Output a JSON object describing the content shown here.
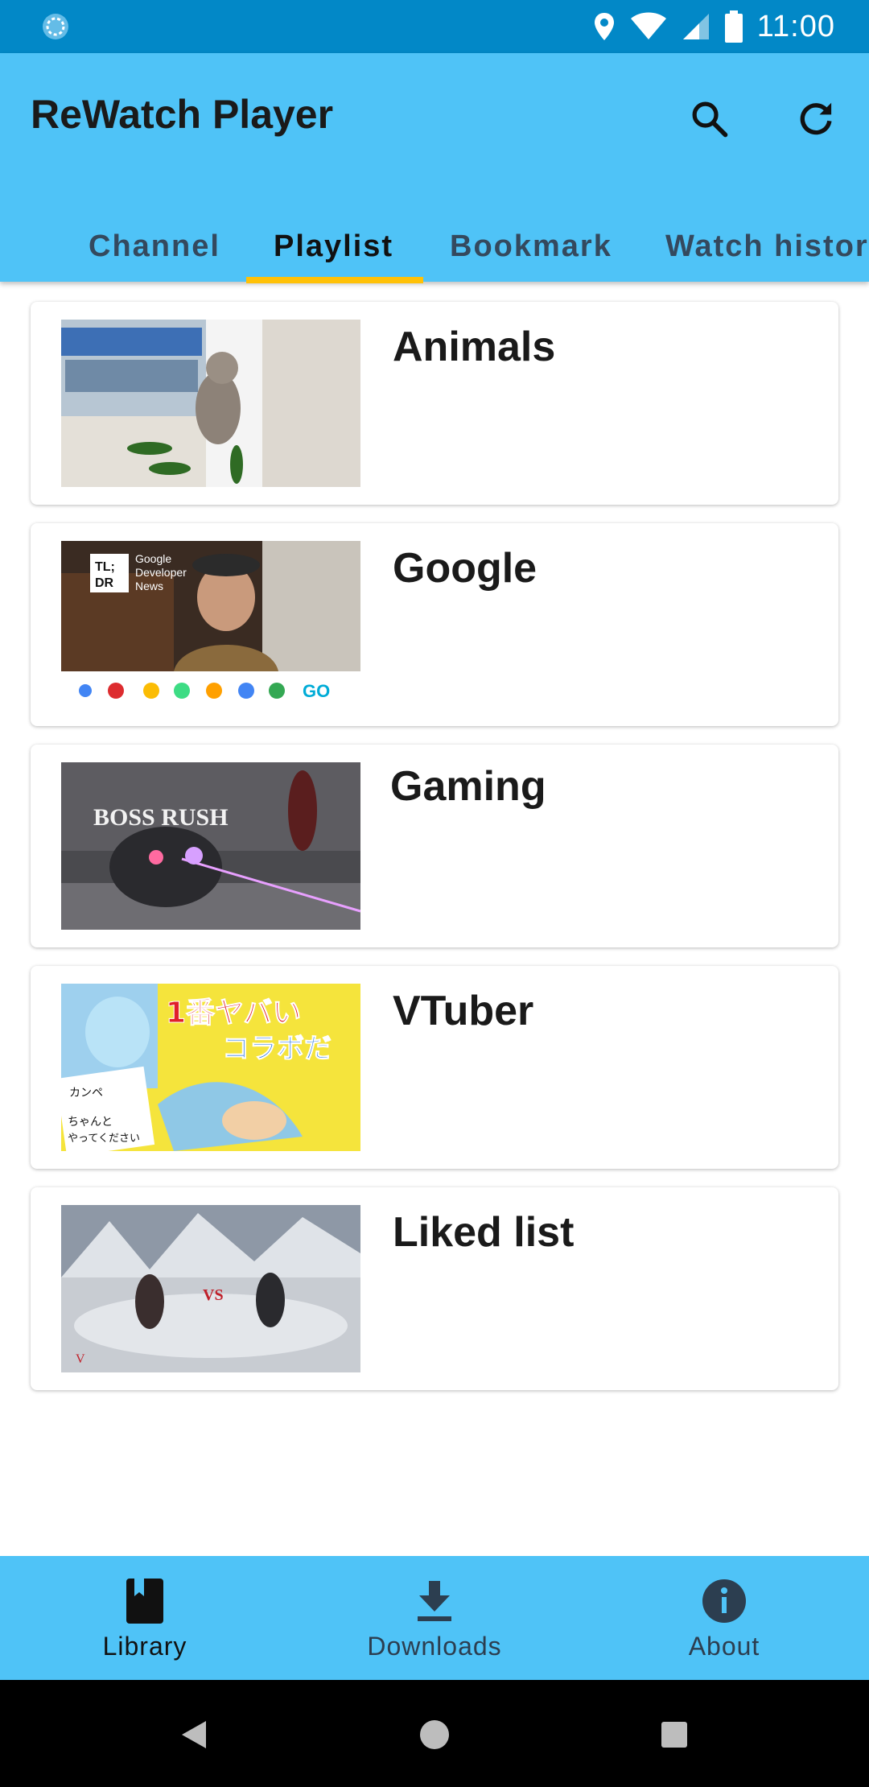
{
  "status_bar": {
    "time": "11:00"
  },
  "app_bar": {
    "title": "ReWatch Player"
  },
  "tabs": [
    {
      "label": "Channel"
    },
    {
      "label": "Playlist"
    },
    {
      "label": "Bookmark"
    },
    {
      "label": "Watch histor"
    }
  ],
  "selected_tab": "Playlist",
  "playlists": [
    {
      "title": "Animals",
      "thumb": "cat-with-cucumbers"
    },
    {
      "title": "Google",
      "thumb": "google-developer-news",
      "thumb_text": [
        "TL;",
        "DR",
        "Google",
        "Developer",
        "News"
      ]
    },
    {
      "title": "Gaming",
      "thumb": "boss-rush",
      "thumb_text": "BOSS RUSH"
    },
    {
      "title": "VTuber",
      "thumb": "vtuber-collab",
      "thumb_text": [
        "1番ヤバい",
        "コラボだ",
        "カンペ",
        "ちゃんと",
        "やってください"
      ]
    },
    {
      "title": "Liked list",
      "thumb": "battle-snow-field",
      "thumb_text": "VS"
    }
  ],
  "bottom_nav": [
    {
      "label": "Library",
      "icon": "book-icon",
      "active": true
    },
    {
      "label": "Downloads",
      "icon": "download-icon",
      "active": false
    },
    {
      "label": "About",
      "icon": "info-icon",
      "active": false
    }
  ],
  "colors": {
    "status_bar": "#0288c7",
    "app_bar": "#4fc3f7",
    "tab_indicator": "#ffc107"
  }
}
